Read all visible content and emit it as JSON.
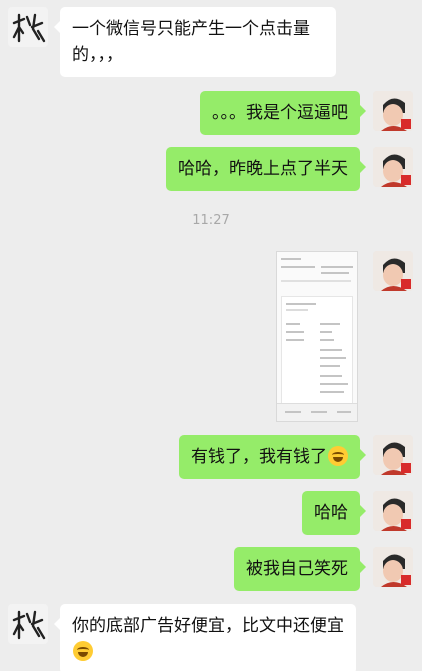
{
  "messages": [
    {
      "side": "left",
      "text": "一个微信号只能产生一个点击量的，，，"
    },
    {
      "side": "right",
      "text": "。。。我是个逗逼吧"
    },
    {
      "side": "right",
      "text": "哈哈，昨晚上点了半天"
    },
    {
      "side": "center",
      "text": "11:27"
    },
    {
      "side": "right",
      "type": "image",
      "text": ""
    },
    {
      "side": "right",
      "text": "有钱了，我有钱了",
      "emoji": "laugh-cry"
    },
    {
      "side": "right",
      "text": "哈哈"
    },
    {
      "side": "right",
      "text": "被我自己笑死"
    },
    {
      "side": "left",
      "text": "你的底部广告好便宜，比文中还便宜",
      "emoji": "laugh-cry"
    }
  ],
  "colors": {
    "background": "#ededed",
    "self_bubble": "#95ec69",
    "other_bubble": "#ffffff"
  },
  "icons": {
    "other_avatar": "handwritten-calligraphy-avatar",
    "self_avatar": "photo-avatar",
    "emoji": "face-with-tears-of-joy"
  }
}
